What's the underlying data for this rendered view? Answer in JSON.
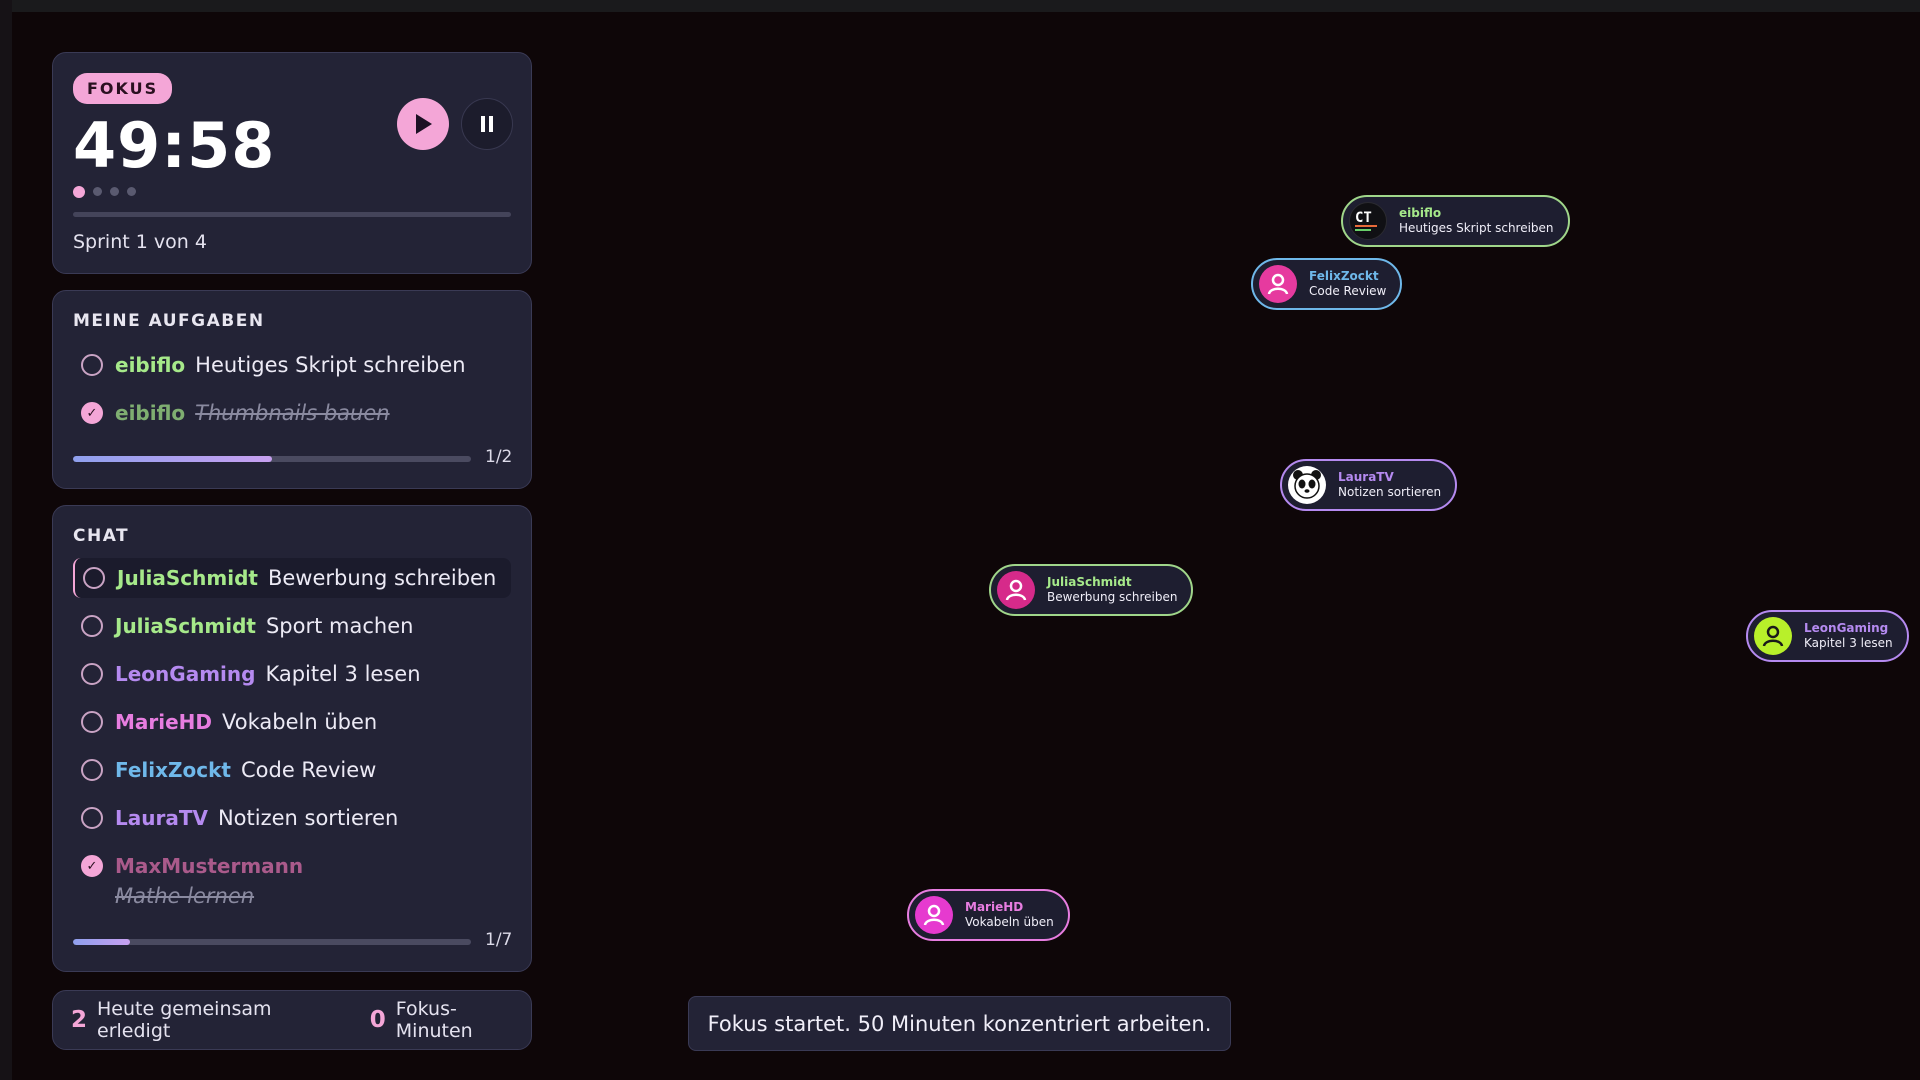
{
  "timer": {
    "mode": "FOKUS",
    "time": "49:58",
    "sprint_label": "Sprint 1 von 4",
    "progress": 0.0,
    "sprint_dots": [
      true,
      false,
      false,
      false
    ]
  },
  "tasks": {
    "title": "MEINE AUFGABEN",
    "items": [
      {
        "user": "eibiflo",
        "text": "Heutiges Skript schreiben",
        "done": false
      },
      {
        "user": "eibiflo",
        "text": "Thumbnails bauen",
        "done": true
      }
    ],
    "progress": 0.5,
    "count": "1/2"
  },
  "chat": {
    "title": "CHAT",
    "items": [
      {
        "user": "JuliaSchmidt",
        "text": "Bewerbung schreiben",
        "done": false
      },
      {
        "user": "JuliaSchmidt",
        "text": "Sport machen",
        "done": false
      },
      {
        "user": "LeonGaming",
        "text": "Kapitel 3 lesen",
        "done": false
      },
      {
        "user": "MarieHD",
        "text": "Vokabeln üben",
        "done": false
      },
      {
        "user": "FelixZockt",
        "text": "Code Review",
        "done": false
      },
      {
        "user": "LauraTV",
        "text": "Notizen sortieren",
        "done": false
      },
      {
        "user": "MaxMustermann",
        "text": "Mathe lernen",
        "done": true
      }
    ],
    "progress": 0.142,
    "count": "1/7"
  },
  "stats": {
    "done_count": "2",
    "done_label": "Heute gemeinsam erledigt",
    "minutes_count": "0",
    "minutes_label": "Fokus-Minuten"
  },
  "avatars": [
    {
      "name": "eibiflo",
      "task": "Heutiges Skript schreiben"
    },
    {
      "name": "FelixZockt",
      "task": "Code Review"
    },
    {
      "name": "LauraTV",
      "task": "Notizen sortieren"
    },
    {
      "name": "JuliaSchmidt",
      "task": "Bewerbung schreiben"
    },
    {
      "name": "LeonGaming",
      "task": "Kapitel 3 lesen"
    },
    {
      "name": "MarieHD",
      "task": "Vokabeln üben"
    }
  ],
  "toast": "Fokus startet. 50 Minuten konzentriert arbeiten.",
  "colors": {
    "accent": "#f4a6d7",
    "eibiflo": "#a6e98a",
    "JuliaSchmidt": "#a6e98a",
    "LeonGaming": "#b58af0",
    "MarieHD": "#e77de0",
    "FelixZockt": "#6fb8ea",
    "LauraTV": "#b58af0",
    "MaxMustermann": "#d86da8"
  }
}
